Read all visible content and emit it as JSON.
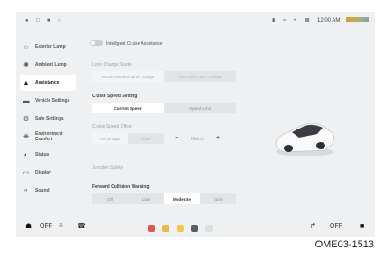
{
  "status": {
    "clock": "12:00 AM",
    "icons_left": [
      "car-icon",
      "book-icon",
      "sound-icon",
      "camera-icon"
    ],
    "icons_right": [
      "microphone-icon",
      "wifi-icon",
      "bluetooth-icon",
      "signal-icon"
    ]
  },
  "sidebar": {
    "items": [
      {
        "label": "Exterior Lamp",
        "icon": "lamp-icon"
      },
      {
        "label": "Ambient Lamp",
        "icon": "ambient-icon"
      },
      {
        "label": "Assistance",
        "icon": "car-assist-icon",
        "active": true
      },
      {
        "label": "Vehicle Settings",
        "icon": "vehicle-icon"
      },
      {
        "label": "Safe Settings",
        "icon": "gear-icon"
      },
      {
        "label": "Environment Comfort",
        "icon": "fan-icon"
      },
      {
        "label": "Status",
        "icon": "gauge-icon"
      },
      {
        "label": "Display",
        "icon": "display-icon"
      },
      {
        "label": "Sound",
        "icon": "speaker-icon"
      }
    ]
  },
  "assist": {
    "toggle_label": "Intelligent Cruise Assistance",
    "lane_change_title": "Lane Change Mode",
    "lane_change_options": [
      "Recommended Lane Change",
      "Automatic Lane Change"
    ],
    "cruise_speed_title": "Cruise Speed Setting",
    "cruise_speed_options": [
      "Current Speed",
      "Speed Limit"
    ],
    "offset_title": "Cruise Speed Offset",
    "offset_options": [
      "Percentage",
      "Fixed"
    ],
    "offset_value": "Match",
    "minus": "−",
    "plus": "+",
    "junction_label": "Junction Safety",
    "fcw_title": "Forward Collision Warning",
    "fcw_options": [
      "Off",
      "Late",
      "Moderate",
      "Early"
    ]
  },
  "bottom": {
    "left_temp": "OFF",
    "right_temp": "OFF"
  },
  "caption": "OME03-1513"
}
